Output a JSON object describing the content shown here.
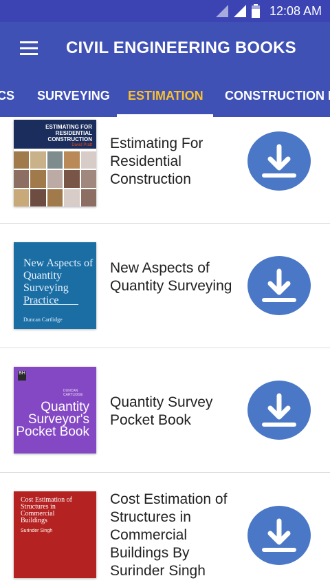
{
  "statusbar": {
    "time": "12:08 AM",
    "icons": [
      "signal-icon",
      "signal-icon",
      "battery-icon"
    ]
  },
  "appbar": {
    "title": "CIVIL ENGINEERING BOOKS",
    "menu_icon": "menu-icon"
  },
  "tabs": {
    "items": [
      {
        "label": "CS"
      },
      {
        "label": "SURVEYING"
      },
      {
        "label": "ESTIMATION"
      },
      {
        "label": "CONSTRUCTION M"
      }
    ],
    "active_index": 2
  },
  "books": [
    {
      "title": "Estimating For Residential Construction",
      "cover": {
        "title": "ESTIMATING FOR RESIDENTIAL CONSTRUCTION",
        "author": "David Pratt"
      }
    },
    {
      "title": "New Aspects of Quantity Surveying",
      "cover": {
        "title": "New Aspects of Quantity Surveying Practice",
        "author": "Duncan Cartlidge"
      }
    },
    {
      "title": "Quantity Survey Pocket Book",
      "cover": {
        "title": "Quantity Surveyor's Pocket Book",
        "author": "DUNCAN CARTLIDGE",
        "logo": "BH"
      }
    },
    {
      "title": "Cost Estimation of Structures in Commercial Buildings By Surinder Singh",
      "cover": {
        "title": "Cost Estimation of Structures in Commercial Buildings",
        "author": "Surinder Singh"
      }
    }
  ],
  "colors": {
    "statusbar": "#3b44b2",
    "appbar": "#3f51b5",
    "tab_active": "#fbc02d",
    "download_button": "#4a78c6"
  },
  "download_icon": "download-icon"
}
